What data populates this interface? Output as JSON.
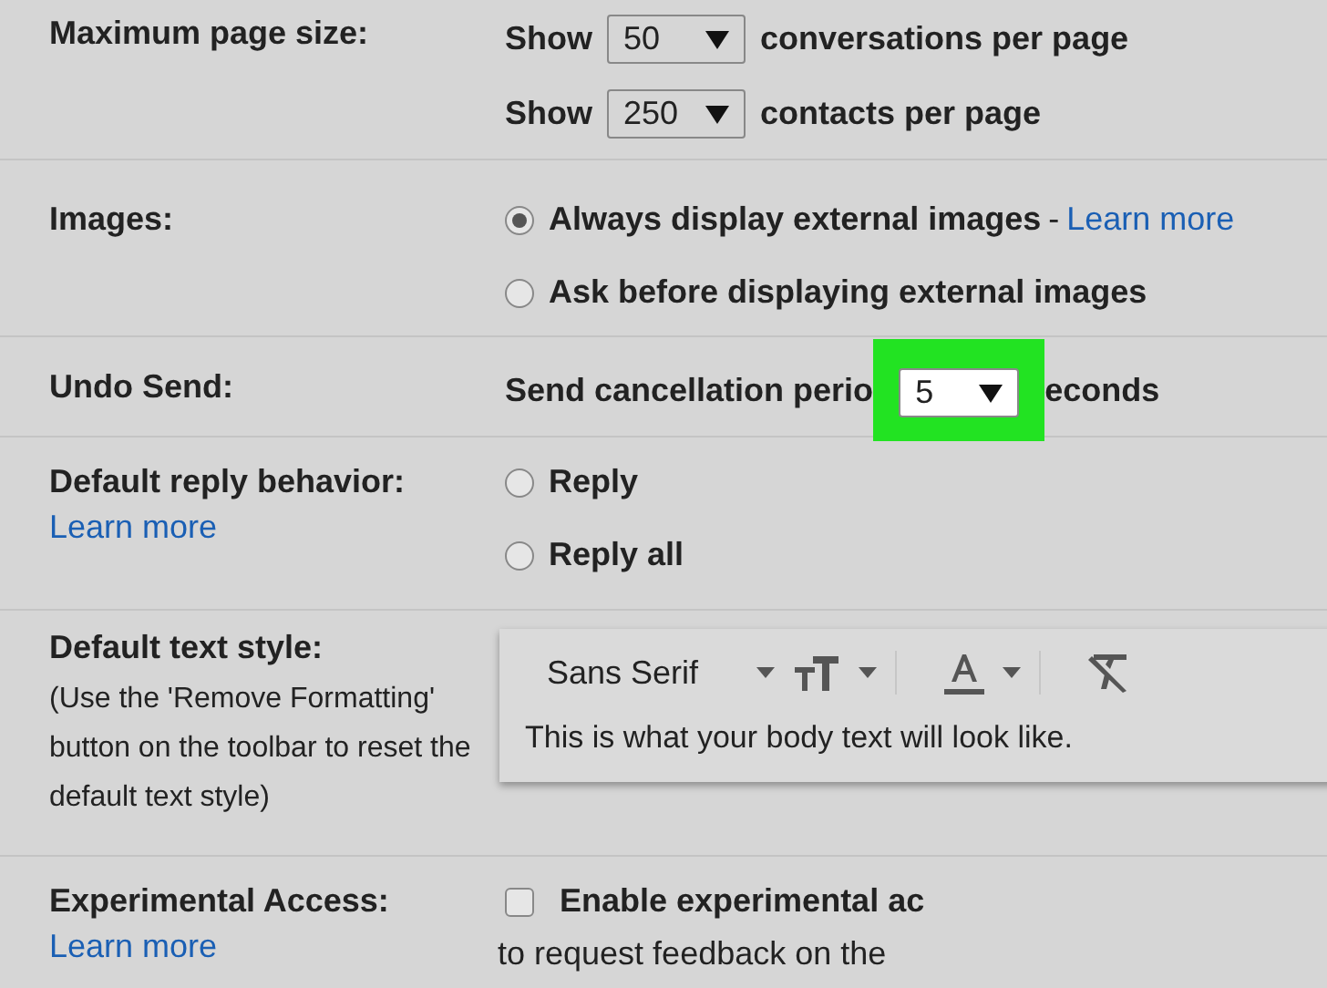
{
  "settings": [
    {
      "kind": "selects",
      "label": "Maximum page size:",
      "lines": [
        {
          "prefix": "Show",
          "value": "50",
          "suffix": "conversations per page"
        },
        {
          "prefix": "Show",
          "value": "250",
          "suffix": "contacts per page"
        }
      ]
    },
    {
      "kind": "radios",
      "label": "Images:",
      "options": [
        {
          "label": "Always display external images",
          "selected": true,
          "separator": "-",
          "link": "Learn more"
        },
        {
          "label": "Ask before displaying external images",
          "selected": false
        }
      ]
    },
    {
      "kind": "undo",
      "label": "Undo Send:",
      "before": "Send cancellation perio",
      "value": "5",
      "after": "econds",
      "highlighted": true
    },
    {
      "kind": "radios",
      "label": "Default reply behavior:",
      "link": "Learn more",
      "options": [
        {
          "label": "Reply",
          "selected": false
        },
        {
          "label": "Reply all",
          "selected": false
        }
      ]
    },
    {
      "kind": "textstyle",
      "label": "Default text style:",
      "note": "(Use the 'Remove Formatting' button on the toolbar to reset the default text style)",
      "font": "Sans Serif",
      "sample": "This is what your body text will look like."
    },
    {
      "kind": "checkbox",
      "label": "Experimental Access:",
      "link": "Learn more",
      "checked": false,
      "title": "Enable experimental ac",
      "description": "to request feedback on the"
    }
  ]
}
